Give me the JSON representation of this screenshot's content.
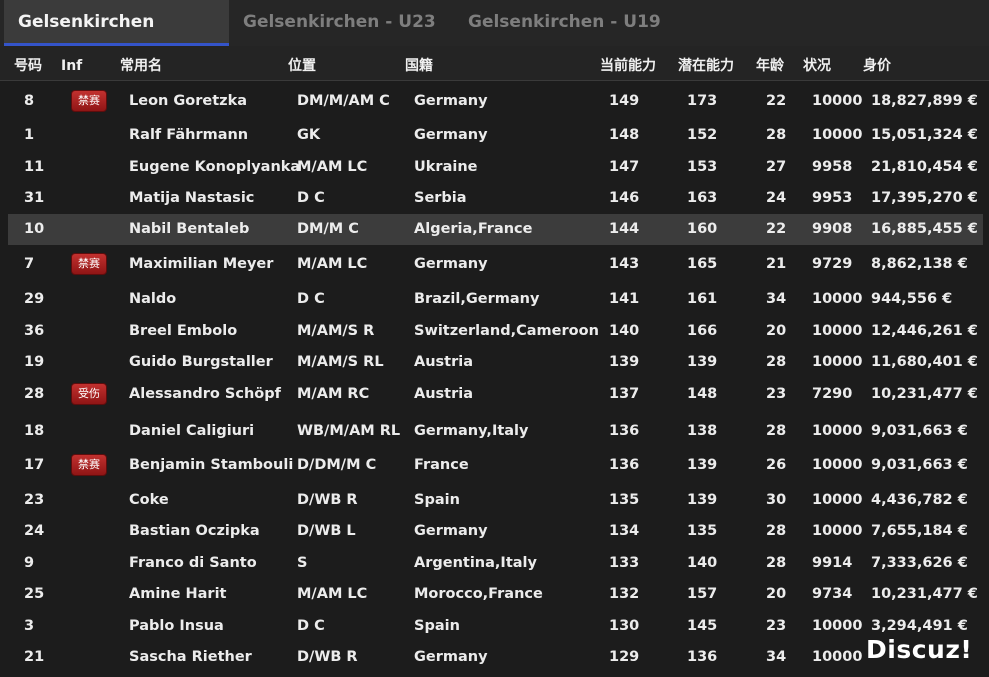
{
  "tabs": [
    {
      "label": "Gelsenkirchen",
      "active": true
    },
    {
      "label": "Gelsenkirchen - U23",
      "active": false
    },
    {
      "label": "Gelsenkirchen - U19",
      "active": false
    }
  ],
  "columns": {
    "number": "号码",
    "inf": "Inf",
    "name": "常用名",
    "position": "位置",
    "nationality": "国籍",
    "current_ability": "当前能力",
    "potential_ability": "潜在能力",
    "age": "年龄",
    "condition": "状况",
    "value": "身价"
  },
  "players": [
    {
      "number": "8",
      "inf": "禁赛",
      "name": "Leon Goretzka",
      "position": "DM/M/AM C",
      "nationality": "Germany",
      "ca": "149",
      "pa": "173",
      "age": "22",
      "condition": "10000",
      "value": "18,827,899 €"
    },
    {
      "number": "1",
      "inf": "",
      "name": "Ralf Fährmann",
      "position": "GK",
      "nationality": "Germany",
      "ca": "148",
      "pa": "152",
      "age": "28",
      "condition": "10000",
      "value": "15,051,324 €"
    },
    {
      "number": "11",
      "inf": "",
      "name": "Eugene Konoplyanka",
      "position": "M/AM LC",
      "nationality": "Ukraine",
      "ca": "147",
      "pa": "153",
      "age": "27",
      "condition": "9958",
      "value": "21,810,454 €"
    },
    {
      "number": "31",
      "inf": "",
      "name": "Matija Nastasic",
      "position": "D C",
      "nationality": "Serbia",
      "ca": "146",
      "pa": "163",
      "age": "24",
      "condition": "9953",
      "value": "17,395,270 €"
    },
    {
      "number": "10",
      "inf": "",
      "name": "Nabil Bentaleb",
      "position": "DM/M C",
      "nationality": "Algeria,France",
      "ca": "144",
      "pa": "160",
      "age": "22",
      "condition": "9908",
      "value": "16,885,455 €",
      "selected": true
    },
    {
      "number": "7",
      "inf": "禁赛",
      "name": "Maximilian Meyer",
      "position": "M/AM LC",
      "nationality": "Germany",
      "ca": "143",
      "pa": "165",
      "age": "21",
      "condition": "9729",
      "value": "8,862,138 €"
    },
    {
      "number": "29",
      "inf": "",
      "name": "Naldo",
      "position": "D C",
      "nationality": "Brazil,Germany",
      "ca": "141",
      "pa": "161",
      "age": "34",
      "condition": "10000",
      "value": "944,556 €"
    },
    {
      "number": "36",
      "inf": "",
      "name": "Breel Embolo",
      "position": "M/AM/S R",
      "nationality": "Switzerland,Cameroon",
      "ca": "140",
      "pa": "166",
      "age": "20",
      "condition": "10000",
      "value": "12,446,261 €"
    },
    {
      "number": "19",
      "inf": "",
      "name": "Guido Burgstaller",
      "position": "M/AM/S RL",
      "nationality": "Austria",
      "ca": "139",
      "pa": "139",
      "age": "28",
      "condition": "10000",
      "value": "11,680,401 €"
    },
    {
      "number": "28",
      "inf": "受伤",
      "name": "Alessandro Schöpf",
      "position": "M/AM RC",
      "nationality": "Austria",
      "ca": "137",
      "pa": "148",
      "age": "23",
      "condition": "7290",
      "value": "10,231,477 €"
    },
    {
      "number": "18",
      "inf": "",
      "name": "Daniel Caligiuri",
      "position": "WB/M/AM RL",
      "nationality": "Germany,Italy",
      "ca": "136",
      "pa": "138",
      "age": "28",
      "condition": "10000",
      "value": "9,031,663 €"
    },
    {
      "number": "17",
      "inf": "禁赛",
      "name": "Benjamin Stambouli",
      "position": "D/DM/M C",
      "nationality": "France",
      "ca": "136",
      "pa": "139",
      "age": "26",
      "condition": "10000",
      "value": "9,031,663 €"
    },
    {
      "number": "23",
      "inf": "",
      "name": "Coke",
      "position": "D/WB R",
      "nationality": "Spain",
      "ca": "135",
      "pa": "139",
      "age": "30",
      "condition": "10000",
      "value": "4,436,782 €"
    },
    {
      "number": "24",
      "inf": "",
      "name": "Bastian Oczipka",
      "position": "D/WB L",
      "nationality": "Germany",
      "ca": "134",
      "pa": "135",
      "age": "28",
      "condition": "10000",
      "value": "7,655,184 €"
    },
    {
      "number": "9",
      "inf": "",
      "name": "Franco di Santo",
      "position": "S",
      "nationality": "Argentina,Italy",
      "ca": "133",
      "pa": "140",
      "age": "28",
      "condition": "9914",
      "value": "7,333,626 €"
    },
    {
      "number": "25",
      "inf": "",
      "name": "Amine Harit",
      "position": "M/AM LC",
      "nationality": "Morocco,France",
      "ca": "132",
      "pa": "157",
      "age": "20",
      "condition": "9734",
      "value": "10,231,477 €"
    },
    {
      "number": "3",
      "inf": "",
      "name": "Pablo Insua",
      "position": "D C",
      "nationality": "Spain",
      "ca": "130",
      "pa": "145",
      "age": "23",
      "condition": "10000",
      "value": "3,294,491 €"
    },
    {
      "number": "21",
      "inf": "",
      "name": "Sascha Riether",
      "position": "D/WB R",
      "nationality": "Germany",
      "ca": "129",
      "pa": "136",
      "age": "34",
      "condition": "10000",
      "value": ""
    }
  ],
  "watermark": "Discuz!",
  "colors": {
    "accent": "#3454c9",
    "badge": "#b52422",
    "selected_row": "#3c3c3c"
  }
}
